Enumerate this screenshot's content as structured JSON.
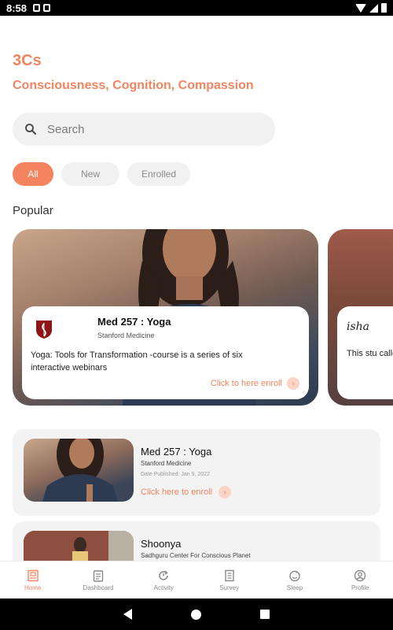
{
  "status_bar": {
    "time": "8:58"
  },
  "app": {
    "title": "3Cs",
    "subtitle": "Consciousness, Cognition, Compassion"
  },
  "search": {
    "placeholder": "Search"
  },
  "filters": [
    {
      "label": "All",
      "active": true
    },
    {
      "label": "New",
      "active": false
    },
    {
      "label": "Enrolled",
      "active": false
    }
  ],
  "popular": {
    "heading": "Popular",
    "cards": [
      {
        "title": "Med 257 : Yoga",
        "org": "Stanford Medicine",
        "description": "Yoga: Tools for Transformation -course is a series of six interactive webinars",
        "cta": "Click to here enroll"
      },
      {
        "logo_text": "isha",
        "description": "This stu called 'S"
      }
    ]
  },
  "list": [
    {
      "title": "Med 257 : Yoga",
      "org": "Stanford Medicine",
      "date": "Date Published: Jan 9, 2022",
      "cta": "Click here to enroll"
    },
    {
      "title": "Shoonya",
      "org": "Sadhguru Center For Conscious Planet"
    }
  ],
  "bottom_nav": [
    {
      "label": "Home",
      "icon": "home-icon",
      "active": true
    },
    {
      "label": "Dashboard",
      "icon": "clipboard-icon",
      "active": false
    },
    {
      "label": "Activity",
      "icon": "refresh-icon",
      "active": false
    },
    {
      "label": "Survey",
      "icon": "survey-icon",
      "active": false
    },
    {
      "label": "Sleep",
      "icon": "sleep-icon",
      "active": false
    },
    {
      "label": "Profile",
      "icon": "person-icon",
      "active": false
    }
  ],
  "colors": {
    "accent": "#f4845f",
    "chip_bg": "#f1f1f1",
    "card_bg": "#f3f3f3"
  }
}
